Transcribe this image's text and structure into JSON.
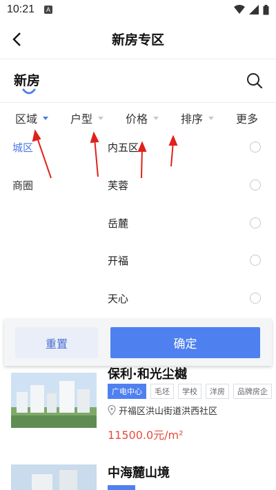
{
  "status": {
    "time": "10:21",
    "badge": "A"
  },
  "nav": {
    "title": "新房专区"
  },
  "section": {
    "title": "新房"
  },
  "filters": [
    {
      "label": "区域",
      "active": true
    },
    {
      "label": "户型",
      "active": false
    },
    {
      "label": "价格",
      "active": false
    },
    {
      "label": "排序",
      "active": false
    },
    {
      "label": "更多",
      "active": false
    }
  ],
  "dropdown": {
    "left": [
      {
        "label": "城区",
        "active": true
      },
      {
        "label": "商圈",
        "active": false
      }
    ],
    "right": [
      {
        "label": "内五区"
      },
      {
        "label": "芙蓉"
      },
      {
        "label": "岳麓"
      },
      {
        "label": "开福"
      },
      {
        "label": "天心"
      }
    ]
  },
  "actions": {
    "reset": "重置",
    "confirm": "确定"
  },
  "listings": [
    {
      "title": "保利·和光尘樾",
      "tags": [
        "广电中心",
        "毛坯",
        "学校",
        "洋房",
        "品牌房企"
      ],
      "address": "开福区洪山街道洪西社区",
      "price": "11500.0元/m²"
    },
    {
      "title": "中海麓山境"
    }
  ],
  "colors": {
    "accent": "#4f80ef",
    "price": "#e84a3c",
    "annotation": "#e0201a"
  }
}
